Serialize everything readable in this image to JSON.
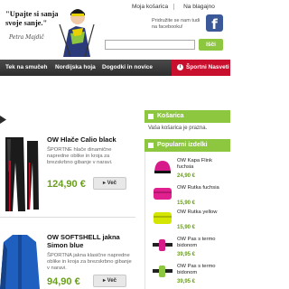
{
  "header": {
    "quote_line1": "\"Upajte si sanjati",
    "quote_line2": "svoje sanje.\"",
    "signature": "Petra Majdič",
    "top_links": [
      "Moja košarica",
      "Na blagajno"
    ],
    "facebook_text": "Pridružite se nam tudi na facebooku!",
    "facebook_icon": "facebook-icon",
    "search_placeholder": "",
    "search_button": "Išči"
  },
  "nav": {
    "items": [
      "Tek na smučeh",
      "Nordijska hoja",
      "Dogodki in novice"
    ],
    "sport_news": "Športni Nasveti"
  },
  "products": [
    {
      "title": "OW Hlače Calio black",
      "description": "ŠPORTNE hlače dinamične napredne oblike in kroja za brezskrbno gibanje v naravi.",
      "price": "124,90 €",
      "button": "Več"
    },
    {
      "title_line1": "OW SOFTSHELL jakna",
      "title_line2": "Simon blue",
      "description": "ŠPORTNA jakna klasične napredne oblike in kroja za brezskrbno gibanje v naravi.",
      "price": "94,90 €",
      "button": "Več"
    }
  ],
  "sidebar": {
    "cart_title": "Košarica",
    "cart_empty": "Vaša košarica je prazna.",
    "popular_title": "Popularni izdelki",
    "popular": [
      {
        "name": "OW Kapa Flink fuchsia",
        "price": "24,90 €"
      },
      {
        "name": "OW Rutka fuchsia",
        "price": "15,90 €"
      },
      {
        "name": "OW Rutka yellow",
        "price": "15,90 €"
      },
      {
        "name": "OW Pas s termo bidonom",
        "price": "39,95 €"
      },
      {
        "name": "OW Pas s termo bidonom",
        "price": "39,95 €"
      }
    ]
  },
  "colors": {
    "accent_green": "#8dc63f",
    "price_green": "#6a9e1f",
    "nav_dark": "#3a3a3a",
    "nav_red": "#c8102e",
    "facebook_blue": "#3b5998"
  }
}
